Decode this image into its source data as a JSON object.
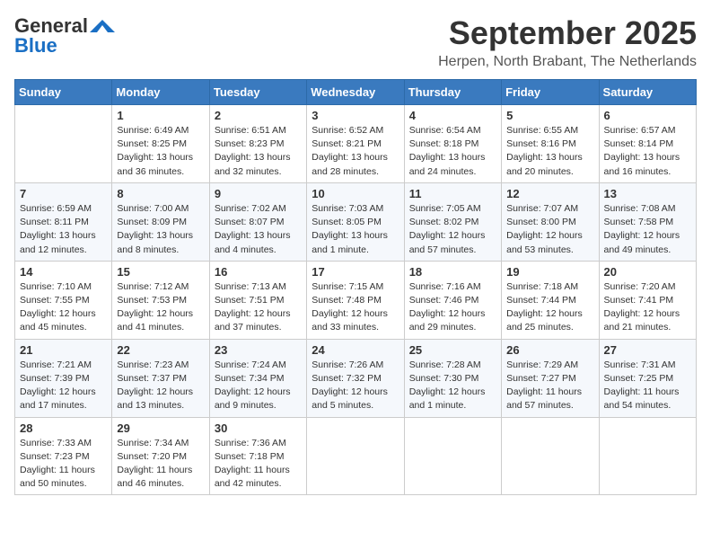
{
  "header": {
    "logo_general": "General",
    "logo_blue": "Blue",
    "month_year": "September 2025",
    "location": "Herpen, North Brabant, The Netherlands"
  },
  "days_of_week": [
    "Sunday",
    "Monday",
    "Tuesday",
    "Wednesday",
    "Thursday",
    "Friday",
    "Saturday"
  ],
  "weeks": [
    [
      {
        "day": "",
        "content": ""
      },
      {
        "day": "1",
        "content": "Sunrise: 6:49 AM\nSunset: 8:25 PM\nDaylight: 13 hours\nand 36 minutes."
      },
      {
        "day": "2",
        "content": "Sunrise: 6:51 AM\nSunset: 8:23 PM\nDaylight: 13 hours\nand 32 minutes."
      },
      {
        "day": "3",
        "content": "Sunrise: 6:52 AM\nSunset: 8:21 PM\nDaylight: 13 hours\nand 28 minutes."
      },
      {
        "day": "4",
        "content": "Sunrise: 6:54 AM\nSunset: 8:18 PM\nDaylight: 13 hours\nand 24 minutes."
      },
      {
        "day": "5",
        "content": "Sunrise: 6:55 AM\nSunset: 8:16 PM\nDaylight: 13 hours\nand 20 minutes."
      },
      {
        "day": "6",
        "content": "Sunrise: 6:57 AM\nSunset: 8:14 PM\nDaylight: 13 hours\nand 16 minutes."
      }
    ],
    [
      {
        "day": "7",
        "content": "Sunrise: 6:59 AM\nSunset: 8:11 PM\nDaylight: 13 hours\nand 12 minutes."
      },
      {
        "day": "8",
        "content": "Sunrise: 7:00 AM\nSunset: 8:09 PM\nDaylight: 13 hours\nand 8 minutes."
      },
      {
        "day": "9",
        "content": "Sunrise: 7:02 AM\nSunset: 8:07 PM\nDaylight: 13 hours\nand 4 minutes."
      },
      {
        "day": "10",
        "content": "Sunrise: 7:03 AM\nSunset: 8:05 PM\nDaylight: 13 hours\nand 1 minute."
      },
      {
        "day": "11",
        "content": "Sunrise: 7:05 AM\nSunset: 8:02 PM\nDaylight: 12 hours\nand 57 minutes."
      },
      {
        "day": "12",
        "content": "Sunrise: 7:07 AM\nSunset: 8:00 PM\nDaylight: 12 hours\nand 53 minutes."
      },
      {
        "day": "13",
        "content": "Sunrise: 7:08 AM\nSunset: 7:58 PM\nDaylight: 12 hours\nand 49 minutes."
      }
    ],
    [
      {
        "day": "14",
        "content": "Sunrise: 7:10 AM\nSunset: 7:55 PM\nDaylight: 12 hours\nand 45 minutes."
      },
      {
        "day": "15",
        "content": "Sunrise: 7:12 AM\nSunset: 7:53 PM\nDaylight: 12 hours\nand 41 minutes."
      },
      {
        "day": "16",
        "content": "Sunrise: 7:13 AM\nSunset: 7:51 PM\nDaylight: 12 hours\nand 37 minutes."
      },
      {
        "day": "17",
        "content": "Sunrise: 7:15 AM\nSunset: 7:48 PM\nDaylight: 12 hours\nand 33 minutes."
      },
      {
        "day": "18",
        "content": "Sunrise: 7:16 AM\nSunset: 7:46 PM\nDaylight: 12 hours\nand 29 minutes."
      },
      {
        "day": "19",
        "content": "Sunrise: 7:18 AM\nSunset: 7:44 PM\nDaylight: 12 hours\nand 25 minutes."
      },
      {
        "day": "20",
        "content": "Sunrise: 7:20 AM\nSunset: 7:41 PM\nDaylight: 12 hours\nand 21 minutes."
      }
    ],
    [
      {
        "day": "21",
        "content": "Sunrise: 7:21 AM\nSunset: 7:39 PM\nDaylight: 12 hours\nand 17 minutes."
      },
      {
        "day": "22",
        "content": "Sunrise: 7:23 AM\nSunset: 7:37 PM\nDaylight: 12 hours\nand 13 minutes."
      },
      {
        "day": "23",
        "content": "Sunrise: 7:24 AM\nSunset: 7:34 PM\nDaylight: 12 hours\nand 9 minutes."
      },
      {
        "day": "24",
        "content": "Sunrise: 7:26 AM\nSunset: 7:32 PM\nDaylight: 12 hours\nand 5 minutes."
      },
      {
        "day": "25",
        "content": "Sunrise: 7:28 AM\nSunset: 7:30 PM\nDaylight: 12 hours\nand 1 minute."
      },
      {
        "day": "26",
        "content": "Sunrise: 7:29 AM\nSunset: 7:27 PM\nDaylight: 11 hours\nand 57 minutes."
      },
      {
        "day": "27",
        "content": "Sunrise: 7:31 AM\nSunset: 7:25 PM\nDaylight: 11 hours\nand 54 minutes."
      }
    ],
    [
      {
        "day": "28",
        "content": "Sunrise: 7:33 AM\nSunset: 7:23 PM\nDaylight: 11 hours\nand 50 minutes."
      },
      {
        "day": "29",
        "content": "Sunrise: 7:34 AM\nSunset: 7:20 PM\nDaylight: 11 hours\nand 46 minutes."
      },
      {
        "day": "30",
        "content": "Sunrise: 7:36 AM\nSunset: 7:18 PM\nDaylight: 11 hours\nand 42 minutes."
      },
      {
        "day": "",
        "content": ""
      },
      {
        "day": "",
        "content": ""
      },
      {
        "day": "",
        "content": ""
      },
      {
        "day": "",
        "content": ""
      }
    ]
  ]
}
